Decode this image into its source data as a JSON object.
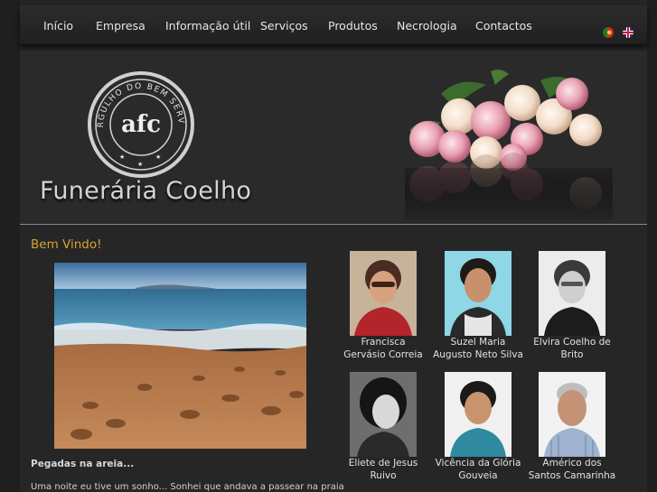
{
  "nav": {
    "items": [
      "Início",
      "Empresa",
      "Informação útil",
      "Serviços",
      "Produtos",
      "Necrologia",
      "Contactos"
    ]
  },
  "languages": [
    {
      "icon": "portugal-flag-icon",
      "label": "PT"
    },
    {
      "icon": "uk-flag-icon",
      "label": "EN"
    }
  ],
  "header": {
    "emblem_top": "ORGULHO DO BEM SERVIR",
    "emblem_monogram": "afc",
    "brand_name": "Funerária Coelho"
  },
  "main": {
    "welcome": "Bem Vindo!",
    "article_title": "Pegadas na areia...",
    "article_text": "Uma noite eu tive um sonho... Sonhei que andava a passear na praia"
  },
  "necrology": [
    {
      "line1": "Francisca",
      "line2": "Gervásio Correia"
    },
    {
      "line1": "Suzel Maria",
      "line2": "Augusto Neto Silva"
    },
    {
      "line1": "Elvira Coelho de",
      "line2": "Brito"
    },
    {
      "line1": "Eliete de Jesus",
      "line2": "Ruivo"
    },
    {
      "line1": "Vicência da Glória",
      "line2": "Gouveia"
    },
    {
      "line1": "Américo dos",
      "line2": "Santos Camarinha"
    }
  ],
  "colors": {
    "accent": "#d6a42a",
    "background": "#262626"
  }
}
